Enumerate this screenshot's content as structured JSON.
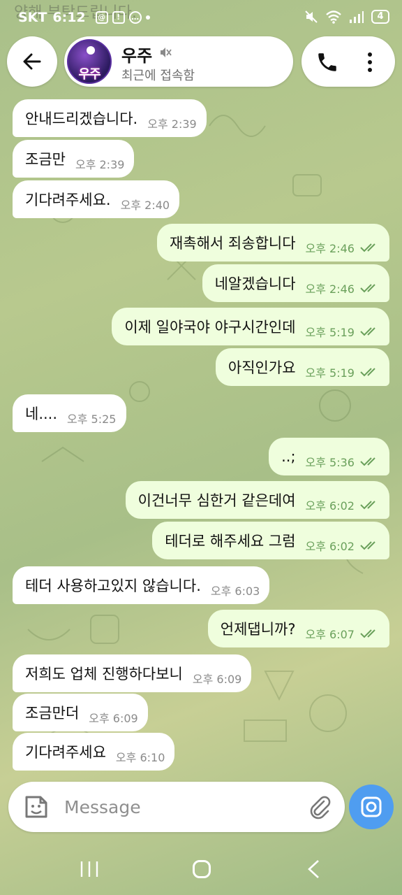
{
  "status_bar": {
    "carrier": "SKT",
    "time": "6:12",
    "battery": "4"
  },
  "header": {
    "contact_name": "우주",
    "contact_status": "최근에 접속함",
    "avatar_text": "우주"
  },
  "faded_message": "양해 부탁드립니다.",
  "messages": [
    {
      "dir": "in",
      "text": "안내드리겠습니다.",
      "time": "오후 2:39"
    },
    {
      "dir": "in",
      "text": "조금만",
      "time": "오후 2:39"
    },
    {
      "dir": "in",
      "text": "기다려주세요.",
      "time": "오후 2:40"
    },
    {
      "dir": "out",
      "text": "재촉해서 죄송합니다",
      "time": "오후 2:46"
    },
    {
      "dir": "out",
      "text": "네알겠습니다",
      "time": "오후 2:46"
    },
    {
      "dir": "out",
      "text": "이제 일야국야 야구시간인데",
      "time": "오후 5:19"
    },
    {
      "dir": "out",
      "text": "아직인가요",
      "time": "오후 5:19"
    },
    {
      "dir": "in",
      "text": "네....",
      "time": "오후 5:25"
    },
    {
      "dir": "out",
      "text": "..;",
      "time": "오후 5:36"
    },
    {
      "dir": "out",
      "text": "이건너무 심한거 같은데여",
      "time": "오후 6:02"
    },
    {
      "dir": "out",
      "text": "테더로 해주세요 그럼",
      "time": "오후 6:02"
    },
    {
      "dir": "in",
      "text": "테더 사용하고있지 않습니다.",
      "time": "오후 6:03"
    },
    {
      "dir": "out",
      "text": "언제댑니까?",
      "time": "오후 6:07"
    },
    {
      "dir": "in",
      "text": "저희도 업체 진행하다보니",
      "time": "오후 6:09"
    },
    {
      "dir": "in",
      "text": "조금만더",
      "time": "오후 6:09"
    },
    {
      "dir": "in",
      "text": "기다려주세요",
      "time": "오후 6:10"
    }
  ],
  "input": {
    "placeholder": "Message"
  },
  "colors": {
    "outgoing_bubble": "#effedd",
    "incoming_bubble": "#ffffff",
    "read_check": "#6aa05b",
    "camera_button": "#4f9df0"
  },
  "icons": [
    "back-arrow-icon",
    "mute-icon",
    "phone-icon",
    "menu-dots-icon",
    "sticker-icon",
    "attach-icon",
    "camera-icon"
  ]
}
